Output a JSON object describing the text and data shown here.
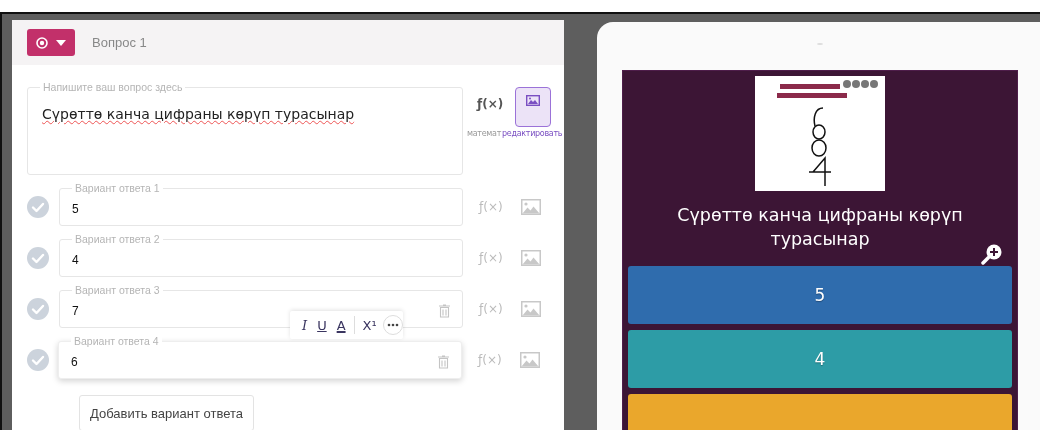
{
  "editor": {
    "header": {
      "title": "Вопрос 1"
    },
    "question": {
      "label": "Напишите ваш вопрос здесь",
      "value": "Сүрөттө канча цифраны көрүп турасынар",
      "math_button": "ƒ(×)",
      "math_label": "математ",
      "image_label": "редактировать",
      "image_active": true
    },
    "choices": [
      {
        "label": "Вариант ответа 1",
        "value": "5",
        "correct": false,
        "focused": false,
        "math_button": "ƒ(×)"
      },
      {
        "label": "Вариант ответа 2",
        "value": "4",
        "correct": false,
        "focused": false,
        "math_button": "ƒ(×)"
      },
      {
        "label": "Вариант ответа 3",
        "value": "7",
        "correct": false,
        "focused": false,
        "hovered": true,
        "math_button": "ƒ(×)"
      },
      {
        "label": "Вариант ответа 4",
        "value": "6",
        "correct": false,
        "focused": true,
        "hovered": true,
        "math_button": "ƒ(×)"
      }
    ],
    "format_toolbar": {
      "italic": "I",
      "underline": "U",
      "text_color": "A",
      "superscript": "X¹"
    },
    "add_button": "Добавить вариант ответа"
  },
  "preview": {
    "question": "Сүрөттө канча цифраны көрүп турасынар",
    "answers": [
      {
        "text": "5",
        "color": "#2f6cad"
      },
      {
        "text": "4",
        "color": "#2d9ca6"
      },
      {
        "color": "#eaa72c"
      }
    ]
  }
}
